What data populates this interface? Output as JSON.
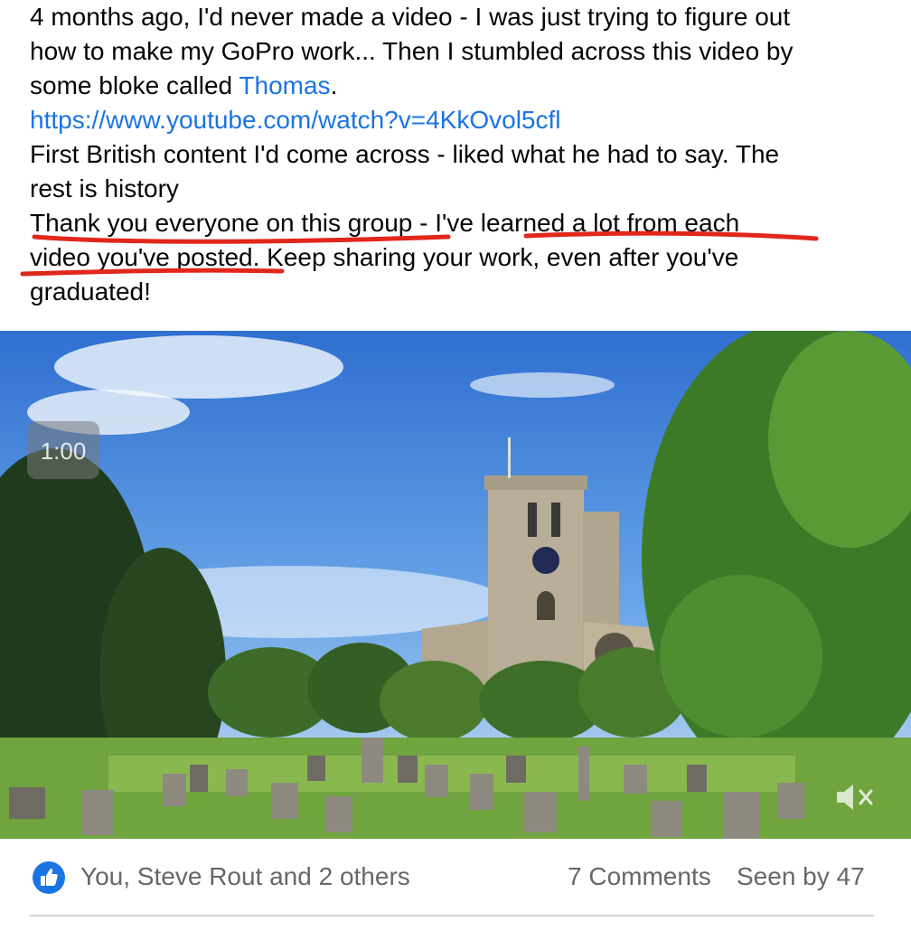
{
  "post": {
    "lines": [
      "4 months ago, I'd never made a video - I was just trying to figure out",
      "how to make my GoPro work... Then I stumbled across this video by",
      "some bloke called ",
      "Thomas",
      ".",
      "https://www.youtube.com/watch?v=4KkOvol5cfl",
      " First British content I'd come across - liked what he had to say. The",
      "rest is history",
      "Thank you everyone on this group",
      " - I've ",
      "learned a lot from each",
      "video you've posted.",
      " Keep sharing your work, even after you've",
      "graduated!"
    ]
  },
  "video": {
    "timer": "1:00",
    "mute_icon": "speaker-muted-icon"
  },
  "footer": {
    "like_icon": "thumbs-up-icon",
    "likes_text": "You, Steve Rout and 2 others",
    "comments_text": "7 Comments",
    "seen_text": "Seen by 47"
  },
  "colors": {
    "link": "#1b74e4",
    "underline": "#e0271b",
    "meta_text": "#65676b"
  }
}
